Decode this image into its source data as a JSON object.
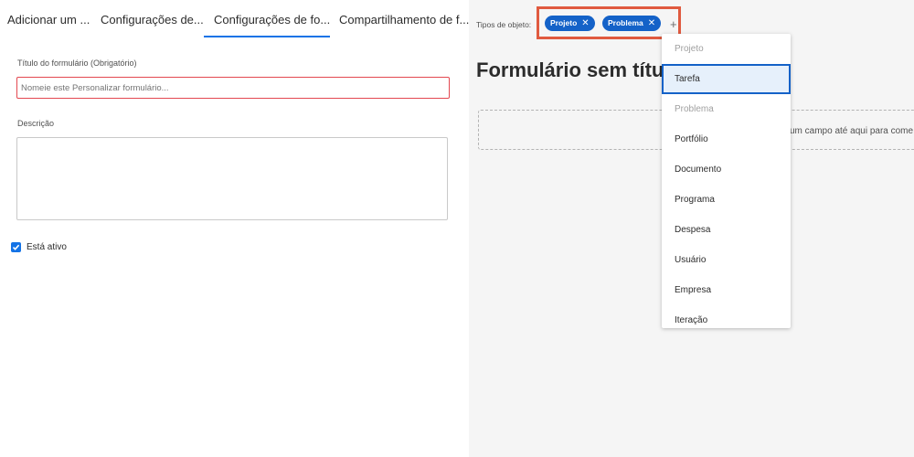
{
  "tabs": [
    {
      "label": "Adicionar um ..."
    },
    {
      "label": "Configurações de..."
    },
    {
      "label": "Configurações de fo..."
    },
    {
      "label": "Compartilhamento de f..."
    }
  ],
  "active_tab_index": 2,
  "form": {
    "title_label": "Título do formulário (Obrigatório)",
    "title_placeholder": "Nomeie este Personalizar formulário...",
    "description_label": "Descrição",
    "active_label": "Está ativo",
    "active_checked": true
  },
  "object_types": {
    "label": "Tipos de objeto:",
    "chips": [
      {
        "label": "Projeto"
      },
      {
        "label": "Problema"
      }
    ],
    "add_symbol": "+"
  },
  "preview": {
    "title": "Formulário sem títu",
    "drop_text": "um campo até aqui para come"
  },
  "dropdown": {
    "items": [
      {
        "label": "Projeto",
        "state": "disabled"
      },
      {
        "label": "Tarefa",
        "state": "selected"
      },
      {
        "label": "Problema",
        "state": "disabled"
      },
      {
        "label": "Portfólio",
        "state": "normal"
      },
      {
        "label": "Documento",
        "state": "normal"
      },
      {
        "label": "Programa",
        "state": "normal"
      },
      {
        "label": "Despesa",
        "state": "normal"
      },
      {
        "label": "Usuário",
        "state": "normal"
      },
      {
        "label": "Empresa",
        "state": "normal"
      },
      {
        "label": "Iteração",
        "state": "normal"
      }
    ]
  },
  "colors": {
    "accent": "#1473e6",
    "chip": "#1462c8",
    "error_border": "#e34850",
    "highlight": "#e05a3f"
  }
}
